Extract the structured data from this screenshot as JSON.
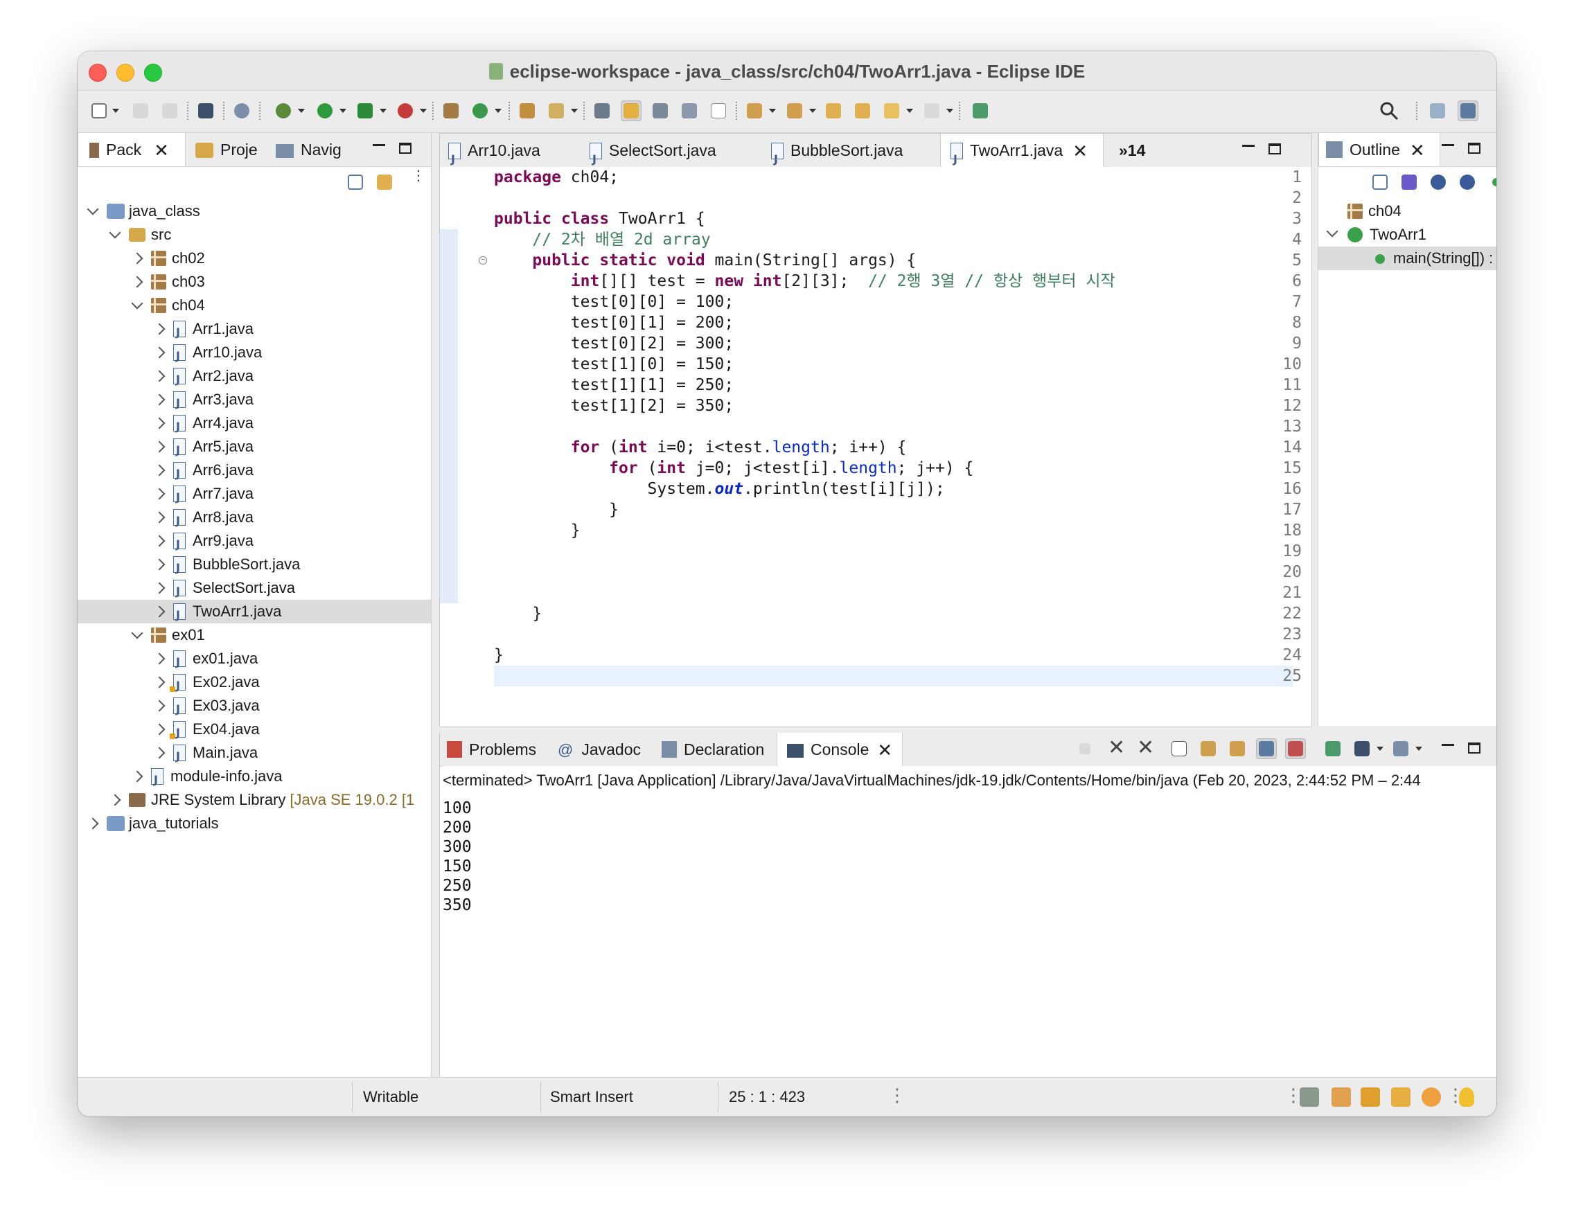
{
  "window": {
    "title": "eclipse-workspace - java_class/src/ch04/TwoArr1.java - Eclipse IDE"
  },
  "left_panel": {
    "tabs": [
      {
        "label": "Pack"
      },
      {
        "label": "Proje"
      },
      {
        "label": "Navig"
      }
    ],
    "tree": [
      {
        "label": "java_class",
        "type": "project",
        "level": 0,
        "expanded": true
      },
      {
        "label": "src",
        "type": "src",
        "level": 1,
        "expanded": true
      },
      {
        "label": "ch02",
        "type": "package",
        "level": 2,
        "expanded": false
      },
      {
        "label": "ch03",
        "type": "package",
        "level": 2,
        "expanded": false
      },
      {
        "label": "ch04",
        "type": "package",
        "level": 2,
        "expanded": true
      },
      {
        "label": "Arr1.java",
        "type": "java",
        "level": 3
      },
      {
        "label": "Arr10.java",
        "type": "java",
        "level": 3
      },
      {
        "label": "Arr2.java",
        "type": "java",
        "level": 3
      },
      {
        "label": "Arr3.java",
        "type": "java",
        "level": 3
      },
      {
        "label": "Arr4.java",
        "type": "java",
        "level": 3
      },
      {
        "label": "Arr5.java",
        "type": "java",
        "level": 3
      },
      {
        "label": "Arr6.java",
        "type": "java",
        "level": 3
      },
      {
        "label": "Arr7.java",
        "type": "java",
        "level": 3
      },
      {
        "label": "Arr8.java",
        "type": "java",
        "level": 3
      },
      {
        "label": "Arr9.java",
        "type": "java",
        "level": 3
      },
      {
        "label": "BubbleSort.java",
        "type": "java",
        "level": 3
      },
      {
        "label": "SelectSort.java",
        "type": "java",
        "level": 3
      },
      {
        "label": "TwoArr1.java",
        "type": "java",
        "level": 3,
        "selected": true
      },
      {
        "label": "ex01",
        "type": "package",
        "level": 2,
        "expanded": true
      },
      {
        "label": "ex01.java",
        "type": "java",
        "level": 3
      },
      {
        "label": "Ex02.java",
        "type": "java-warn",
        "level": 3
      },
      {
        "label": "Ex03.java",
        "type": "java",
        "level": 3
      },
      {
        "label": "Ex04.java",
        "type": "java-warn",
        "level": 3
      },
      {
        "label": "Main.java",
        "type": "java",
        "level": 3
      },
      {
        "label": "module-info.java",
        "type": "java",
        "level": 2,
        "expanded": false
      },
      {
        "label": "JRE System Library",
        "decor": "[Java SE 19.0.2 [1",
        "type": "jre",
        "level": 1,
        "expanded": false
      },
      {
        "label": "java_tutorials",
        "type": "project",
        "level": 0,
        "expanded": false
      }
    ]
  },
  "editor": {
    "tabs": [
      {
        "label": "Arr10.java"
      },
      {
        "label": "SelectSort.java"
      },
      {
        "label": "BubbleSort.java"
      },
      {
        "label": "TwoArr1.java",
        "active": true
      }
    ],
    "overflow": "»14",
    "lines": [
      {
        "n": "1",
        "html": "<span class=\"kw\">package</span> ch04;"
      },
      {
        "n": "2",
        "html": ""
      },
      {
        "n": "3",
        "html": "<span class=\"kw\">public</span> <span class=\"kw\">class</span> TwoArr1 {"
      },
      {
        "n": "4",
        "html": "    <span class=\"cm\">// 2차 배열 2d array</span>"
      },
      {
        "n": "5",
        "html": "    <span class=\"kw\">public</span> <span class=\"kw\">static</span> <span class=\"kw\">void</span> main(String[] args) {"
      },
      {
        "n": "6",
        "html": "        <span class=\"kw\">int</span>[][] test = <span class=\"kw\">new</span> <span class=\"kw\">int</span>[2][3];  <span class=\"cm\">// 2행 3열 // 항상 행부터 시작</span>"
      },
      {
        "n": "7",
        "html": "        test[0][0] = 100;"
      },
      {
        "n": "8",
        "html": "        test[0][1] = 200;"
      },
      {
        "n": "9",
        "html": "        test[0][2] = 300;"
      },
      {
        "n": "10",
        "html": "        test[1][0] = 150;"
      },
      {
        "n": "11",
        "html": "        test[1][1] = 250;"
      },
      {
        "n": "12",
        "html": "        test[1][2] = 350;"
      },
      {
        "n": "13",
        "html": ""
      },
      {
        "n": "14",
        "html": "        <span class=\"kw\">for</span> (<span class=\"kw\">int</span> i=0; i&lt;test.<span class=\"fd\">length</span>; i++) {"
      },
      {
        "n": "15",
        "html": "            <span class=\"kw\">for</span> (<span class=\"kw\">int</span> j=0; j&lt;test[i].<span class=\"fd\">length</span>; j++) {"
      },
      {
        "n": "16",
        "html": "                System.<span class=\"fds\">out</span>.println(test[i][j]);"
      },
      {
        "n": "17",
        "html": "            }"
      },
      {
        "n": "18",
        "html": "        }"
      },
      {
        "n": "19",
        "html": ""
      },
      {
        "n": "20",
        "html": ""
      },
      {
        "n": "21",
        "html": ""
      },
      {
        "n": "22",
        "html": "    }"
      },
      {
        "n": "23",
        "html": ""
      },
      {
        "n": "24",
        "html": "}"
      },
      {
        "n": "25",
        "html": ""
      }
    ]
  },
  "outline": {
    "tab": "Outline",
    "items": [
      {
        "label": "ch04",
        "type": "package"
      },
      {
        "label": "TwoArr1",
        "type": "class"
      },
      {
        "label": "main(String[]) : void",
        "type": "method"
      }
    ]
  },
  "bottom_panel": {
    "tabs": [
      {
        "label": "Problems"
      },
      {
        "label": "Javadoc"
      },
      {
        "label": "Declaration"
      },
      {
        "label": "Console",
        "active": true
      }
    ],
    "terminated": "<terminated> TwoArr1 [Java Application] /Library/Java/JavaVirtualMachines/jdk-19.jdk/Contents/Home/bin/java  (Feb 20, 2023, 2:44:52 PM – 2:44",
    "output": [
      "100",
      "200",
      "300",
      "150",
      "250",
      "350"
    ]
  },
  "status": {
    "writable": "Writable",
    "insert_mode": "Smart Insert",
    "position": "25 : 1 : 423"
  }
}
